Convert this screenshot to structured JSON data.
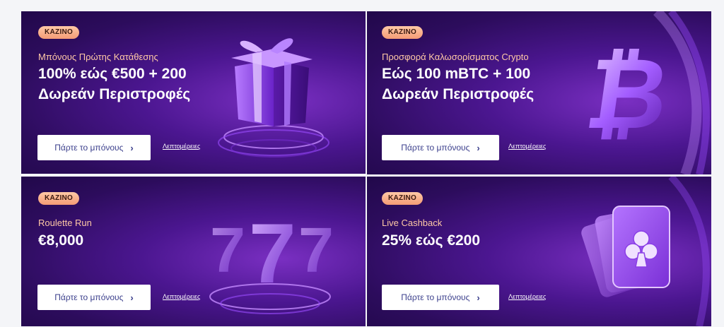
{
  "cards": [
    {
      "badge": "ΚΑΖΙΝΟ",
      "subtitle": "Μπόνους Πρώτης Κατάθεσης",
      "headline": "100% εώς €500 + 200 Δωρεάν Περιστροφές",
      "cta": "Πάρτε το μπόνους",
      "details": "Λεπτομέρειες",
      "art_icon": "gift-box-icon"
    },
    {
      "badge": "ΚΑΖΙΝΟ",
      "subtitle": "Προσφορά Καλωσορίσματος Crypto",
      "headline": "Εώς 100 mBTC + 100 Δωρεάν Περιστροφές",
      "cta": "Πάρτε το μπόνους",
      "details": "Λεπτομέρειες",
      "art_icon": "bitcoin-icon"
    },
    {
      "badge": "ΚΑΖΙΝΟ",
      "subtitle": "Roulette Run",
      "headline": "€8,000",
      "cta": "Πάρτε το μπόνους",
      "details": "Λεπτομέρειες",
      "art_icon": "triple-seven-icon"
    },
    {
      "badge": "ΚΑΖΙΝΟ",
      "subtitle": "Live Cashback",
      "headline": "25% εώς €200",
      "cta": "Πάρτε το μπόνους",
      "details": "Λεπτομέρειες",
      "art_icon": "playing-cards-club-icon"
    }
  ],
  "colors": {
    "card_bg": "#2c0c5c",
    "accent_purple": "#9b4dff",
    "badge_bg": "#f49b75",
    "subtitle": "#ffc9a6",
    "cta_text": "#3b3f8c"
  }
}
